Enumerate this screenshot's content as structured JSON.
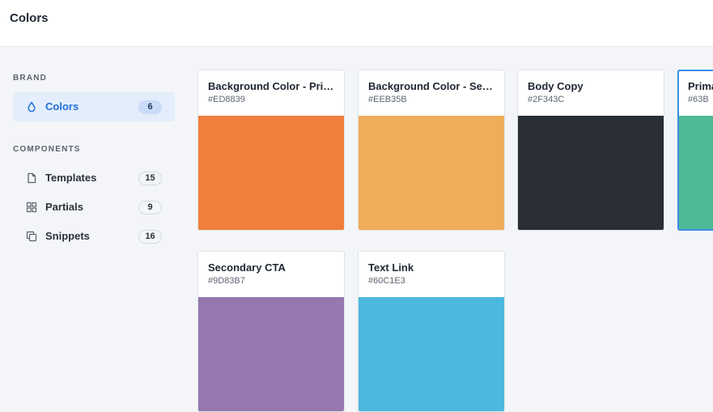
{
  "header": {
    "title": "Colors"
  },
  "sidebar": {
    "brand_label": "BRAND",
    "components_label": "COMPONENTS",
    "items": [
      {
        "label": "Colors",
        "count": "6",
        "icon": "droplet-icon"
      },
      {
        "label": "Templates",
        "count": "15",
        "icon": "file-icon"
      },
      {
        "label": "Partials",
        "count": "9",
        "icon": "grid-icon"
      },
      {
        "label": "Snippets",
        "count": "16",
        "icon": "copy-icon"
      }
    ]
  },
  "colors": [
    {
      "name": "Background Color - Primary",
      "hex": "#ED8839"
    },
    {
      "name": "Background Color - Secondary",
      "hex": "#EEB35B"
    },
    {
      "name": "Body Copy",
      "hex": "#2F343C"
    },
    {
      "name": "Primary CTA",
      "hex": "#63B"
    },
    {
      "name": "Secondary CTA",
      "hex": "#9D83B7"
    },
    {
      "name": "Text Link",
      "hex": "#60C1E3"
    }
  ],
  "swatch_colors": [
    "#ef7f3a",
    "#efad5a",
    "#292e37",
    "#4fb996",
    "#9678b0",
    "#4cb8df"
  ],
  "accent": "#1f6fd9"
}
